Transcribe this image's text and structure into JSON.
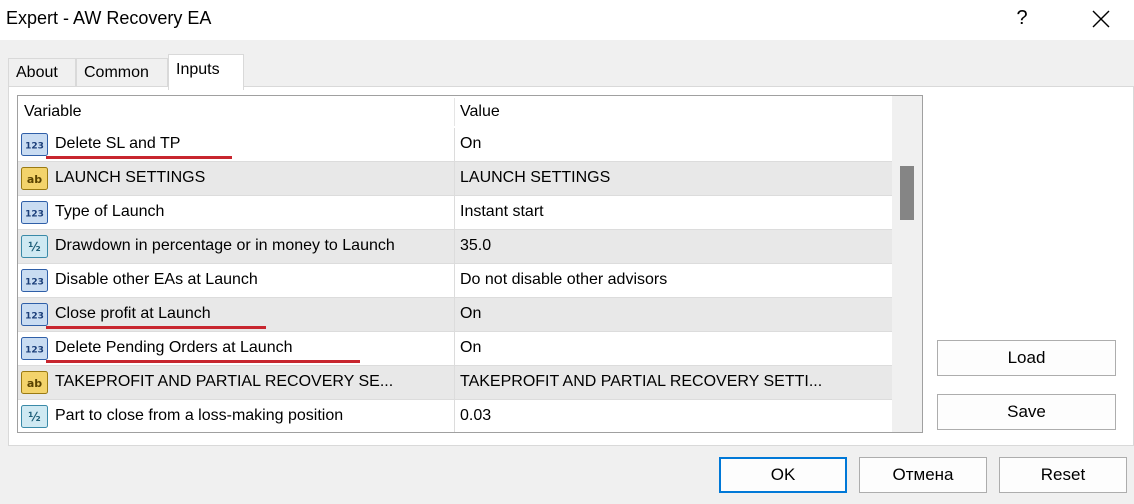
{
  "window": {
    "title": "Expert - AW Recovery EA",
    "help": "?"
  },
  "tabs": [
    {
      "label": "About"
    },
    {
      "label": "Common"
    },
    {
      "label": "Inputs"
    }
  ],
  "grid": {
    "headers": {
      "variable": "Variable",
      "value": "Value"
    },
    "rows": [
      {
        "icon": "int",
        "variable": "Delete SL and TP",
        "value": "On"
      },
      {
        "icon": "string",
        "variable": "LAUNCH SETTINGS",
        "value": "LAUNCH SETTINGS"
      },
      {
        "icon": "int",
        "variable": "Type of Launch",
        "value": "Instant start"
      },
      {
        "icon": "double",
        "variable": "Drawdown in percentage or in money to Launch",
        "value": "35.0"
      },
      {
        "icon": "int",
        "variable": "Disable other EAs at Launch",
        "value": "Do not disable other advisors"
      },
      {
        "icon": "int",
        "variable": "Close profit at Launch",
        "value": "On"
      },
      {
        "icon": "int",
        "variable": "Delete Pending Orders at Launch",
        "value": "On"
      },
      {
        "icon": "string",
        "variable": "TAKEPROFIT AND PARTIAL RECOVERY SE...",
        "value": "TAKEPROFIT AND PARTIAL RECOVERY SETTI..."
      },
      {
        "icon": "double",
        "variable": "Part to close from a loss-making position",
        "value": "0.03"
      }
    ]
  },
  "icon_labels": {
    "int": "123",
    "string": "ab",
    "double": "½"
  },
  "buttons": {
    "load": "Load",
    "save": "Save",
    "ok": "OK",
    "cancel": "Отмена",
    "reset": "Reset"
  },
  "colors": {
    "accent": "#0078d7",
    "highlight_underline": "#c8262f"
  }
}
